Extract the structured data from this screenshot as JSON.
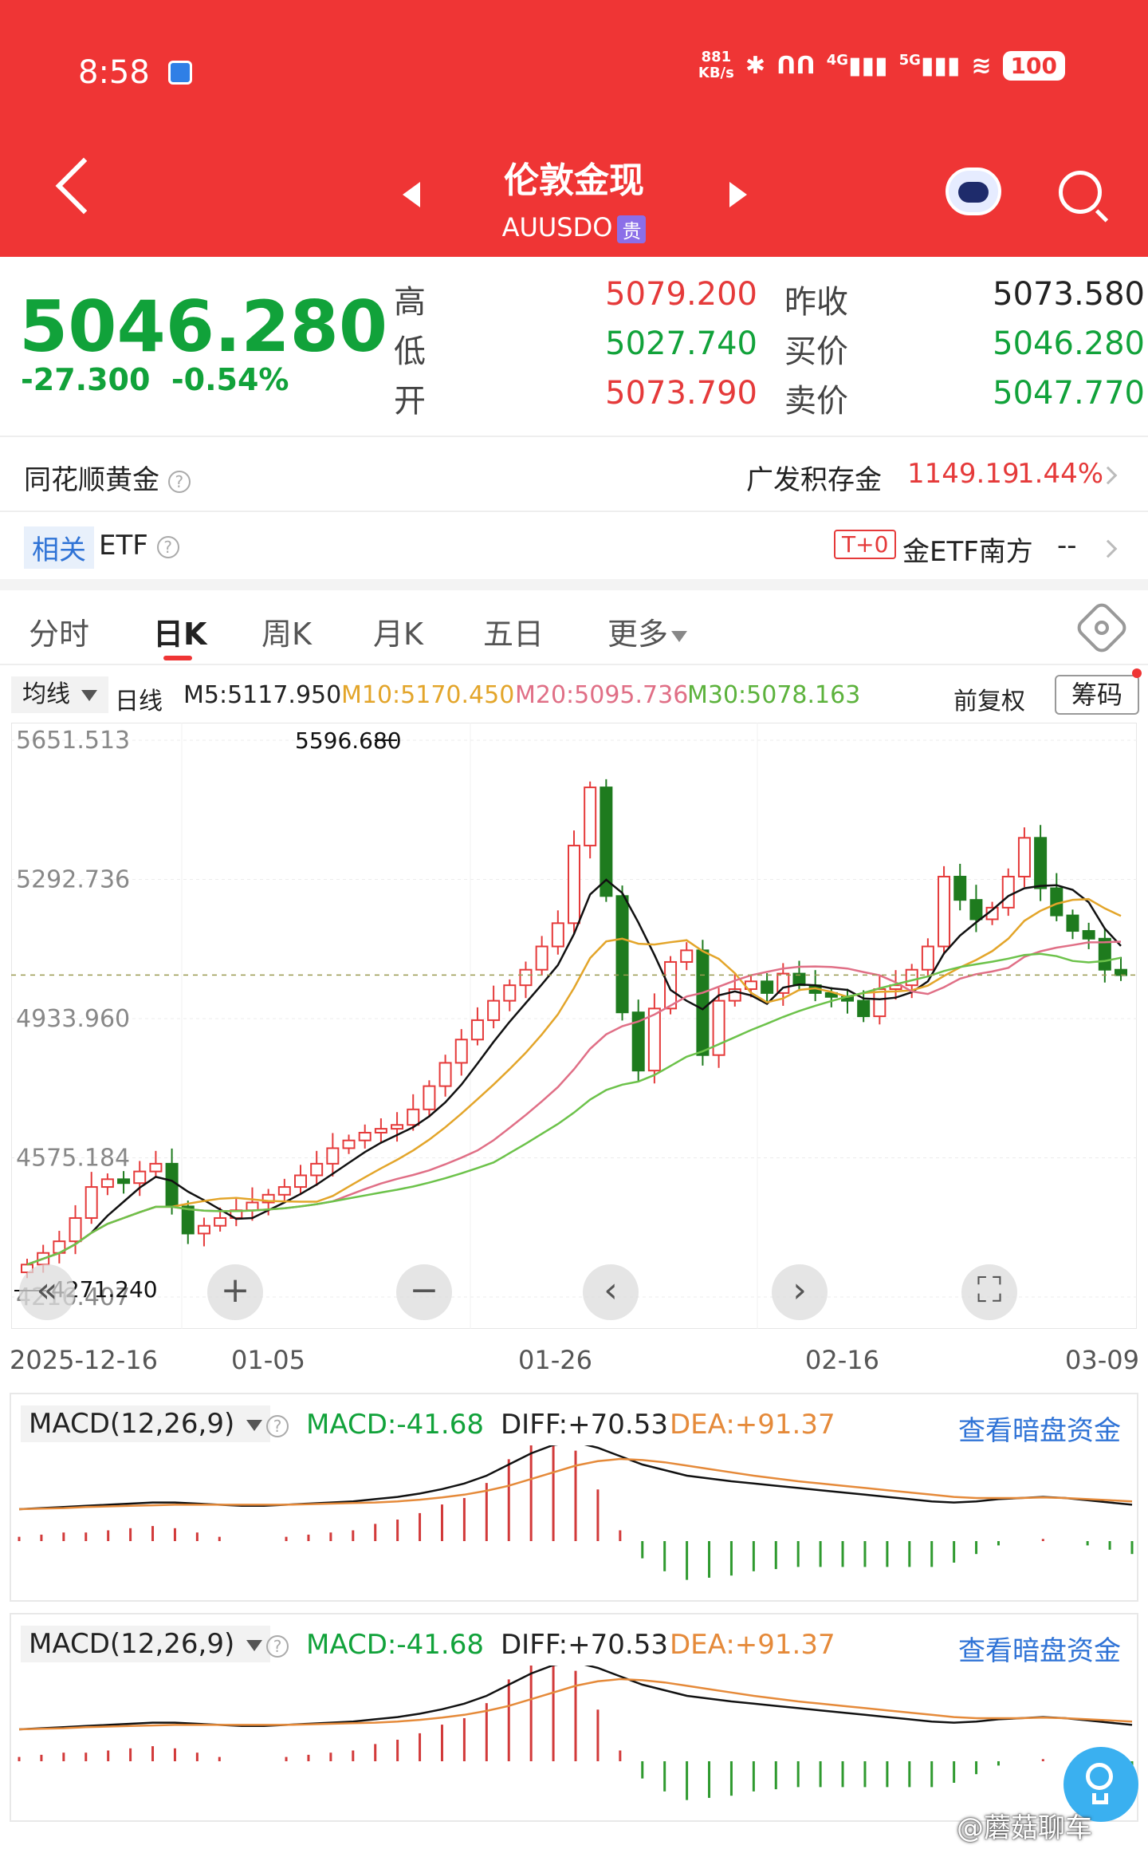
{
  "status": {
    "time": "8:58",
    "speed_value": "881",
    "speed_unit": "KB/s",
    "net1": "4G",
    "net2": "5G",
    "battery": "100"
  },
  "header": {
    "title": "伦敦金现",
    "symbol": "AUUSDO",
    "tag": "贵"
  },
  "quote": {
    "price": "5046.280",
    "change": "-27.300",
    "change_pct": "-0.54%",
    "high_label": "高",
    "high": "5079.200",
    "low_label": "低",
    "low": "5027.740",
    "open_label": "开",
    "open": "5073.790",
    "prev_label": "昨收",
    "prev": "5073.580",
    "bid_label": "买价",
    "bid": "5046.280",
    "ask_label": "卖价",
    "ask": "5047.770"
  },
  "related1": {
    "label": "同花顺黄金",
    "right_label": "广发积存金",
    "right_value": "1149.19",
    "right_pct": "1.44%"
  },
  "related2": {
    "tag": "相关",
    "label": "ETF",
    "badge": "T+0",
    "right_label": "金ETF南方",
    "right_value": "--"
  },
  "tabs": [
    "分时",
    "日K",
    "周K",
    "月K",
    "五日",
    "更多"
  ],
  "ma_bar": {
    "selector": "均线",
    "line_type": "日线",
    "m5": "M5:5117.950",
    "m10": "M10:5170.450",
    "m20": "M20:5095.736",
    "m30": "M30:5078.163",
    "adjust": "前复权",
    "chip": "筹码"
  },
  "colors": {
    "header_red": "#ef3535",
    "up_red": "#e53a3a",
    "down_green": "#1e7b1e",
    "ma5": "#111111",
    "ma10": "#e3a52a",
    "ma20": "#e06f86",
    "ma30": "#6cc24a"
  },
  "chart_data": {
    "type": "candlestick",
    "y_ticks": [
      "5651.513",
      "5292.736",
      "4933.960",
      "4575.184",
      "4216.407"
    ],
    "ylim": [
      4216.407,
      5651.513
    ],
    "max_label": "5596.680",
    "min_label": "4271.240",
    "x_ticks": [
      "2025-12-16",
      "01-05",
      "01-26",
      "02-16",
      "03-09"
    ]
  },
  "macd": {
    "selector": "MACD(12,26,9)",
    "macd": "MACD:-41.68",
    "diff": "DIFF:+70.53",
    "dea": "DEA:+91.37",
    "link": "查看暗盘资金"
  },
  "watermark": "@蘑菇聊车"
}
